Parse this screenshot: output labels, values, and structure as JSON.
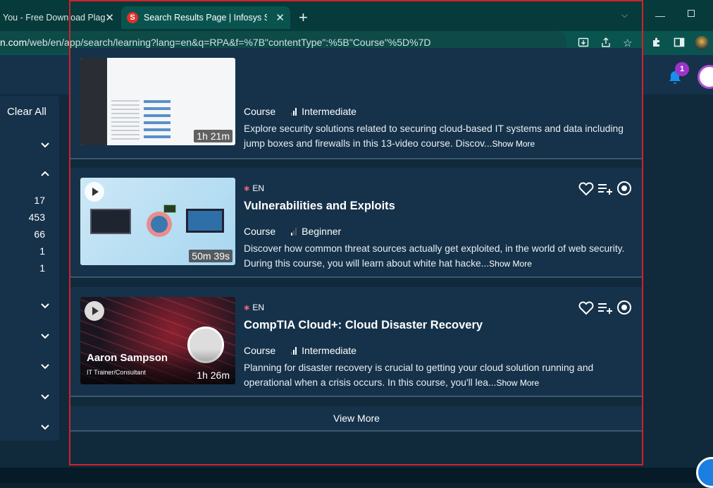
{
  "browser": {
    "tabs": [
      {
        "title": "You - Free Download Plag",
        "active": false
      },
      {
        "title": "Search Results Page | Infosys Spr",
        "active": true
      }
    ],
    "url_host": "n.com",
    "url_path": "/web/en/app/search/learning?lang=en&q=RPA&f=%7B\"contentType\":%5B\"Course\"%5D%7D"
  },
  "search": {
    "language": "EN",
    "query": "RPA"
  },
  "notifications": {
    "count": "1"
  },
  "filters": {
    "clear_all": "Clear All",
    "counts": [
      "17",
      "453",
      "66",
      "1",
      "1"
    ]
  },
  "results": [
    {
      "type": "Course",
      "level": "Intermediate",
      "duration": "1h 21m",
      "description": "Explore security solutions related to securing cloud-based IT systems and data including jump boxes and firewalls in this 13-video course. Discov...",
      "show_more": "Show More"
    },
    {
      "language": "EN",
      "title": "Vulnerabilities and Exploits",
      "type": "Course",
      "level": "Beginner",
      "duration": "50m 39s",
      "description": "Discover how common threat sources actually get exploited, in the world of web security. During this course, you will learn about white hat hacke...",
      "show_more": "Show More"
    },
    {
      "language": "EN",
      "title": "CompTIA Cloud+: Cloud Disaster Recovery",
      "type": "Course",
      "level": "Intermediate",
      "duration": "1h 26m",
      "instructor_name": "Aaron Sampson",
      "instructor_role": "IT Trainer/Consultant",
      "description": "Planning for disaster recovery is crucial to getting your cloud solution running and operational when a crisis occurs. In this course, you'll lea...",
      "show_more": "Show More"
    }
  ],
  "view_more": "View More",
  "colors": {
    "accent_purple": "#9b34c9",
    "highlight_red": "#d4202a",
    "bell_blue": "#1a8ef0"
  }
}
